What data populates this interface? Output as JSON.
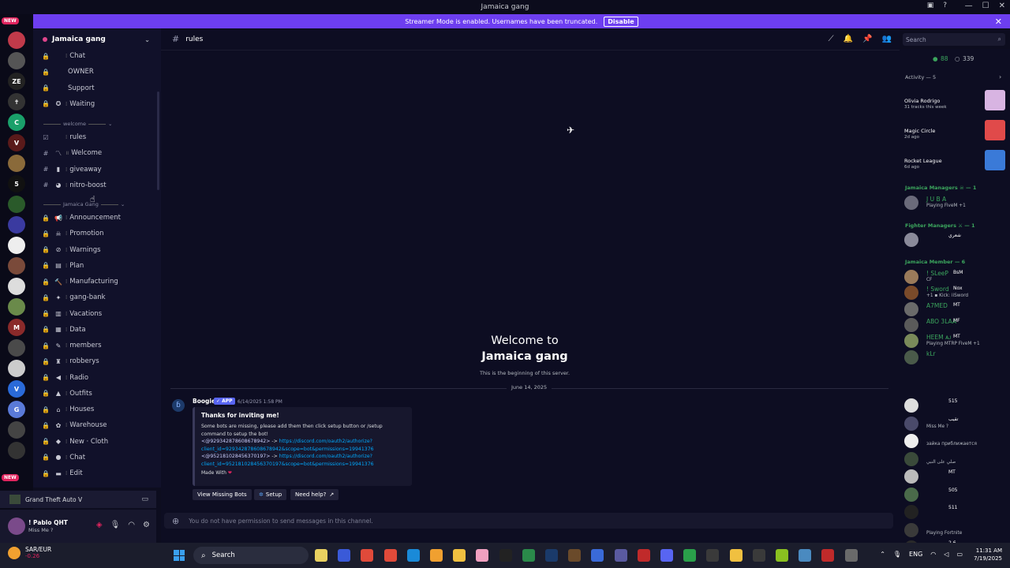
{
  "window": {
    "title": "Jamaica gang"
  },
  "banner": {
    "text": "Streamer Mode is enabled. Usernames have been truncated.",
    "button": "Disable"
  },
  "server": {
    "name": "Jamaica gang"
  },
  "rail": {
    "new_badge_top": "NEW",
    "new_badge_bottom": "NEW",
    "badge_count": "1"
  },
  "sidebar": {
    "channels_top": [
      {
        "icon": "lock",
        "emoji": "",
        "label": "Chat",
        "sep": "⁞"
      },
      {
        "icon": "lock",
        "emoji": "",
        "label": "OWNER",
        "sep": ""
      },
      {
        "icon": "lock",
        "emoji": "",
        "label": "Support",
        "sep": ""
      },
      {
        "icon": "lock",
        "emoji": "✪",
        "label": "Waiting",
        "sep": "⁞"
      }
    ],
    "category_welcome": "welcome",
    "channels_welcome": [
      {
        "icon": "rules",
        "emoji": "",
        "label": "rules",
        "sep": "⁞"
      },
      {
        "icon": "hash",
        "emoji": "〽",
        "label": "Welcome",
        "sep": "॥"
      },
      {
        "icon": "hash",
        "emoji": "▮",
        "label": "giveaway",
        "sep": "⁞"
      },
      {
        "icon": "hash",
        "emoji": "◕",
        "label": "nitro-boost",
        "sep": "⁞"
      }
    ],
    "category_gang": "Jamaica Gang",
    "channels_gang": [
      {
        "icon": "lock",
        "emoji": "📢",
        "label": "Announcement",
        "sep": "⁞"
      },
      {
        "icon": "lock",
        "emoji": "☠",
        "label": "Promotion",
        "sep": "⁞"
      },
      {
        "icon": "lock",
        "emoji": "⊘",
        "label": "Warnings",
        "sep": "⁞"
      },
      {
        "icon": "lock",
        "emoji": "▤",
        "label": "Plan",
        "sep": "⁞"
      },
      {
        "icon": "lock",
        "emoji": "🔨",
        "label": "Manufacturing",
        "sep": "⁞"
      },
      {
        "icon": "lock",
        "emoji": "✦",
        "label": "gang-bank",
        "sep": "⁞"
      },
      {
        "icon": "lock",
        "emoji": "▥",
        "label": "Vacations",
        "sep": "⁞"
      },
      {
        "icon": "lock",
        "emoji": "▦",
        "label": "Data",
        "sep": "⁞"
      },
      {
        "icon": "lock",
        "emoji": "✎",
        "label": "members",
        "sep": "⁞"
      },
      {
        "icon": "lock",
        "emoji": "♜",
        "label": "robberys",
        "sep": "⁞"
      },
      {
        "icon": "lock",
        "emoji": "◀",
        "label": "Radio",
        "sep": "⁞"
      },
      {
        "icon": "lock",
        "emoji": "▲",
        "label": "Outfits",
        "sep": "⁞"
      },
      {
        "icon": "lock",
        "emoji": "⌂",
        "label": "Houses",
        "sep": "⁞"
      },
      {
        "icon": "lock",
        "emoji": "✿",
        "label": "Warehouse",
        "sep": "⁞"
      },
      {
        "icon": "lock",
        "emoji": "◆",
        "label": "New · Cloth",
        "sep": "⁞"
      },
      {
        "icon": "lock",
        "emoji": "●",
        "label": "Chat",
        "sep": "⁞"
      },
      {
        "icon": "lock",
        "emoji": "▬",
        "label": "Edit",
        "sep": "⁞"
      }
    ]
  },
  "game_activity": {
    "name": "Grand Theft Auto V"
  },
  "user": {
    "name": "! Pablo QHT",
    "status": "Miss Me ?"
  },
  "channel": {
    "name": "rules"
  },
  "search": {
    "placeholder": "Search"
  },
  "welcome": {
    "line1": "Welcome to",
    "line2": "Jamaica gang",
    "subtitle": "This is the beginning of this server.",
    "date": "June 14, 2025"
  },
  "message": {
    "author": "Boogie",
    "app_badge": "✓ APP",
    "time": "6/14/2025 1:58 PM",
    "embed_title": "Thanks for inviting me!",
    "lines": [
      "Some bots are missing, please add them then click setup button or /setup",
      "command to setup the bot!"
    ],
    "mention1": "<@929342878608678942>",
    "link1a": "https://discord.com/oauth2/authorize?",
    "link1b": "client_id=929342878608678942&scope=bot&permissions=19941376",
    "mention2": "<@952181028456370197>",
    "link2a": "https://discord.com/oauth2/authorize?",
    "link2b": "client_id=952181028456370197&scope=bot&permissions=19941376",
    "arrow": "->",
    "footer": "Made With",
    "buttons": [
      "View Missing Bots",
      "Setup",
      "Need help?"
    ]
  },
  "composer": {
    "placeholder": "You do not have permission to send messages in this channel."
  },
  "members": {
    "online": "88",
    "total": "339",
    "activity_header": "Activity — 5",
    "activities": [
      {
        "name": "Olivia Rodrigo",
        "status": "31 tracks this week",
        "color": "#d8b4e2"
      },
      {
        "name": "Magic Circle",
        "status": "2d ago",
        "color": "#e04a4a"
      },
      {
        "name": "Rocket League",
        "status": "6d ago",
        "color": "#3a7ad8"
      }
    ],
    "sections": [
      {
        "title": "Jamaica Managers ☠ — 1"
      },
      {
        "title": "Fighter Managers ⚔ — 1"
      },
      {
        "title": "Jamaica Member — 6"
      }
    ],
    "managers": [
      {
        "name": "J U B A",
        "status": "Playing FiveM +1"
      }
    ],
    "fighter": [
      {
        "name": "",
        "badge": "شعري"
      }
    ],
    "member_rows": [
      {
        "name": "! SLeeP",
        "badge": "BsM",
        "status": "CF"
      },
      {
        "name": "! Sword",
        "badge": "Nox",
        "status": "+1 ▪ Kick: iiSword"
      },
      {
        "name": "A7MED",
        "badge": "MT",
        "status": ""
      },
      {
        "name": "ABO 3LAA",
        "badge": "MF",
        "status": ""
      },
      {
        "name": "HEEM ᴀᴊ",
        "badge": "MT",
        "status": "Playing MTRP FiveM +1"
      },
      {
        "name": "kLr",
        "badge": "",
        "status": ""
      }
    ],
    "offline_rows": [
      {
        "name": "",
        "badge": "515",
        "status": ""
      },
      {
        "name": "",
        "badge": "تقيب",
        "status": "Miss Me ?"
      },
      {
        "name": "",
        "badge": "",
        "status": "зайка приближается"
      },
      {
        "name": "",
        "badge": "",
        "status": "صلي على النبي"
      },
      {
        "name": "",
        "badge": "MT",
        "status": ""
      },
      {
        "name": "",
        "badge": "505",
        "status": ""
      },
      {
        "name": "",
        "badge": "511",
        "status": ""
      },
      {
        "name": "",
        "badge": "",
        "status": "Playing Fortnite"
      },
      {
        "name": "",
        "badge": "2.6",
        "status": "M"
      }
    ]
  },
  "taskbar": {
    "weather_title": "SAR/EUR",
    "weather_value": "-0.26",
    "search": "Search",
    "lang": "ENG",
    "time": "11:31 AM",
    "date": "7/19/2025"
  }
}
